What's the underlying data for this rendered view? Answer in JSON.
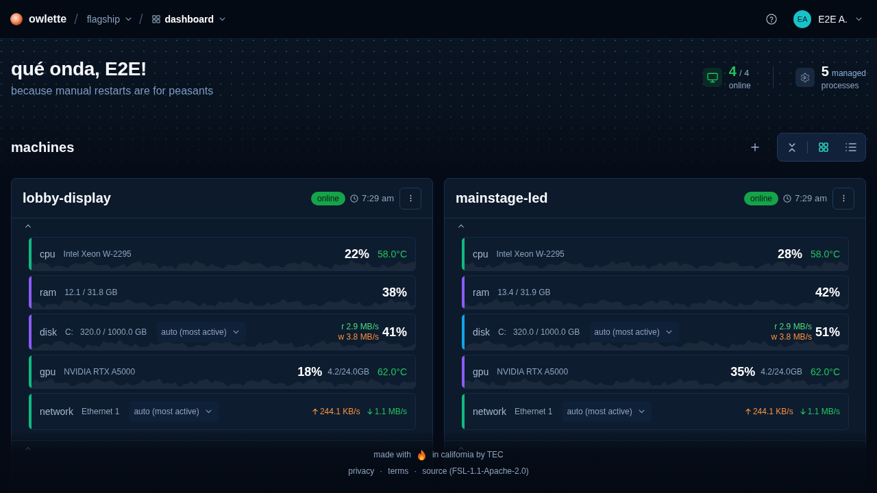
{
  "nav": {
    "brand": "owlette",
    "breadcrumbs": [
      {
        "kind": "workspace",
        "separator": "/",
        "label": "flagship"
      },
      {
        "kind": "page",
        "separator": "/",
        "label": "dashboard"
      }
    ],
    "user": {
      "initials": "EA",
      "name": "E2E A."
    }
  },
  "hero": {
    "title": "qué onda, E2E!",
    "subtitle": "because manual restarts are for peasants",
    "stats": [
      {
        "kind": "machines",
        "value": "4",
        "total": "/ 4",
        "label": "online"
      },
      {
        "kind": "processes",
        "value": "5",
        "unit": "managed",
        "label": "processes"
      }
    ]
  },
  "machines": {
    "title": "machines",
    "views": [
      {
        "kind": "grid",
        "selected": true
      },
      {
        "kind": "list",
        "selected": false
      }
    ],
    "cards": [
      {
        "name": "lobby-display",
        "status": "online",
        "time": "7:29 am",
        "sections": [
          {
            "expanded": true,
            "metrics": [
              {
                "kind": "cpu",
                "color": "#10b981",
                "label": "cpu",
                "detail": "Intel Xeon W-2295",
                "usage": "22%",
                "temperature": "58.0°C"
              },
              {
                "kind": "ram",
                "color": "#8b5cf6",
                "label": "ram",
                "detail": "12.1 / 31.8 GB",
                "usage": "38%"
              },
              {
                "kind": "disk",
                "color": "#8b5cf6",
                "label": "disk",
                "drive": "C:",
                "detail": "320.0 / 1000.0 GB",
                "source": "auto (most active)",
                "read": "r 2.9 MB/s",
                "write": "w 3.8 MB/s",
                "usage": "41%"
              },
              {
                "kind": "gpu",
                "color": "#10b981",
                "label": "gpu",
                "detail": "NVIDIA RTX A5000",
                "usage": "18%",
                "memory": "4.2/24.0GB",
                "temperature": "62.0°C"
              },
              {
                "kind": "network",
                "color": "#10b981",
                "label": "network",
                "detail": "Ethernet 1",
                "source": "auto (most active)",
                "upload": "244.1 KB/s",
                "download": "1.1 MB/s"
              }
            ]
          },
          {
            "expanded": true
          }
        ]
      },
      {
        "name": "mainstage-led",
        "status": "online",
        "time": "7:29 am",
        "sections": [
          {
            "expanded": true,
            "metrics": [
              {
                "kind": "cpu",
                "color": "#10b981",
                "label": "cpu",
                "detail": "Intel Xeon W-2295",
                "usage": "28%",
                "temperature": "58.0°C"
              },
              {
                "kind": "ram",
                "color": "#8b5cf6",
                "label": "ram",
                "detail": "13.4 / 31.9 GB",
                "usage": "42%"
              },
              {
                "kind": "disk",
                "color": "#0ea5e9",
                "label": "disk",
                "drive": "C:",
                "detail": "320.0 / 1000.0 GB",
                "source": "auto (most active)",
                "read": "r 2.9 MB/s",
                "write": "w 3.8 MB/s",
                "usage": "51%"
              },
              {
                "kind": "gpu",
                "color": "#8b5cf6",
                "label": "gpu",
                "detail": "NVIDIA RTX A5000",
                "usage": "35%",
                "memory": "4.2/24.0GB",
                "temperature": "62.0°C"
              },
              {
                "kind": "network",
                "color": "#10b981",
                "label": "network",
                "detail": "Ethernet 1",
                "source": "auto (most active)",
                "upload": "244.1 KB/s",
                "download": "1.1 MB/s"
              }
            ]
          },
          {
            "expanded": true
          }
        ]
      }
    ]
  },
  "footer": {
    "made_with": "made with",
    "made_in": "in california by TEC",
    "links": [
      "privacy",
      "terms",
      "source (FSL-1.1-Apache-2.0)"
    ],
    "separators": [
      "·",
      "·"
    ]
  }
}
